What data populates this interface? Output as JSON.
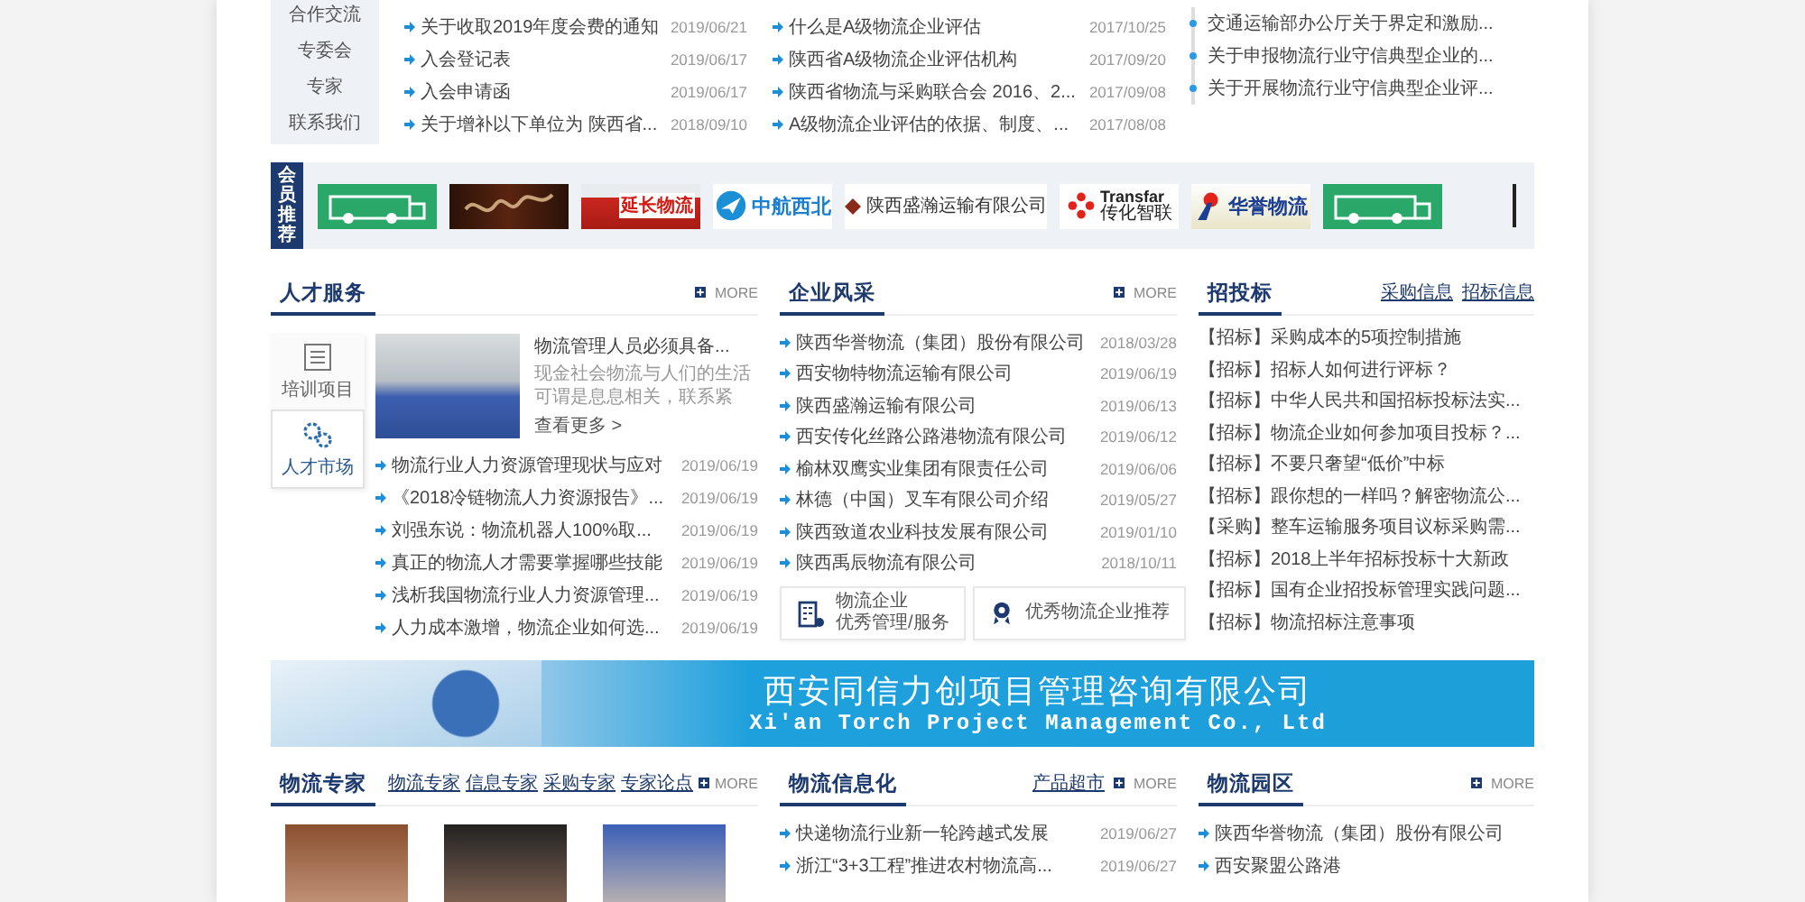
{
  "top": {
    "nav": [
      "合作交流",
      "专委会",
      "专家",
      "联系我们"
    ],
    "list_1": [
      {
        "title": "关于收取2019年度会费的通知",
        "date": "2019/06/21"
      },
      {
        "title": "入会登记表",
        "date": "2019/06/17"
      },
      {
        "title": "入会申请函",
        "date": "2019/06/17"
      },
      {
        "title": "关于增补以下单位为 陕西省...",
        "date": "2018/09/10"
      }
    ],
    "list_2": [
      {
        "title": "什么是A级物流企业评估",
        "date": "2017/10/25"
      },
      {
        "title": "陕西省A级物流企业评估机构",
        "date": "2017/09/20"
      },
      {
        "title": "陕西省物流与采购联合会 2016、2...",
        "date": "2017/09/08"
      },
      {
        "title": "A级物流企业评估的依据、制度、...",
        "date": "2017/08/08"
      }
    ],
    "list_3": [
      "交通运输部办公厅关于界定和激励...",
      "关于申报物流行业守信典型企业的...",
      "关于开展物流行业守信典型企业评..."
    ]
  },
  "members": {
    "badge": "会员推荐",
    "logos": [
      {
        "kind": "green"
      },
      {
        "kind": "script"
      },
      {
        "kind": "truck",
        "text": "延长物流"
      },
      {
        "kind": "plane",
        "text": "中航西北"
      },
      {
        "kind": "diamond",
        "text": "陕西盛瀚运输有限公司"
      },
      {
        "kind": "transfar",
        "text": "Transfar",
        "sub": "传化智联"
      },
      {
        "kind": "huayu",
        "text": "华誉物流"
      },
      {
        "kind": "green"
      }
    ]
  },
  "talent": {
    "title": "人才服务",
    "more": "MORE",
    "tabs": [
      {
        "label": "培训项目",
        "kind": "list",
        "selected": false
      },
      {
        "label": "人才市场",
        "kind": "gears",
        "selected": true
      }
    ],
    "feature": {
      "title": "物流管理人员必须具备...",
      "desc": "现金社会物流与人们的生活可谓是息息相关，联系紧",
      "link": "查看更多 >"
    },
    "items": [
      {
        "title": "物流行业人力资源管理现状与应对",
        "date": "2019/06/19"
      },
      {
        "title": "《2018冷链物流人力资源报告》...",
        "date": "2019/06/19"
      },
      {
        "title": "刘强东说：物流机器人100%取...",
        "date": "2019/06/19"
      },
      {
        "title": "真正的物流人才需要掌握哪些技能",
        "date": "2019/06/19"
      },
      {
        "title": "浅析我国物流行业人力资源管理...",
        "date": "2019/06/19"
      },
      {
        "title": "人力成本激增，物流企业如何选...",
        "date": "2019/06/19"
      }
    ]
  },
  "companies": {
    "title": "企业风采",
    "more": "MORE",
    "items": [
      {
        "title": "陕西华誉物流（集团）股份有限公司",
        "date": "2018/03/28"
      },
      {
        "title": "西安物特物流运输有限公司",
        "date": "2019/06/19"
      },
      {
        "title": "陕西盛瀚运输有限公司",
        "date": "2019/06/13"
      },
      {
        "title": "西安传化丝路公路港物流有限公司",
        "date": "2019/06/12"
      },
      {
        "title": "榆林双鹰实业集团有限责任公司",
        "date": "2019/06/06"
      },
      {
        "title": "林德（中国）叉车有限公司介绍",
        "date": "2019/05/27"
      },
      {
        "title": "陕西致道农业科技发展有限公司",
        "date": "2019/01/10"
      },
      {
        "title": "陕西禹辰物流有限公司",
        "date": "2018/10/11"
      }
    ],
    "buttons": [
      {
        "kind": "building",
        "lines": [
          "物流企业",
          "优秀管理/服务"
        ]
      },
      {
        "kind": "award",
        "lines": [
          "优秀物流企业推荐"
        ]
      }
    ]
  },
  "bidding": {
    "title": "招投标",
    "links": [
      "采购信息",
      "招标信息"
    ],
    "items": [
      "【招标】采购成本的5项控制措施",
      "【招标】招标人如何进行评标？",
      "【招标】中华人民共和国招标投标法实...",
      "【招标】物流企业如何参加项目投标？...",
      "【招标】不要只奢望“低价”中标",
      "【招标】跟你想的一样吗？解密物流公...",
      "【采购】整车运输服务项目议标采购需...",
      "【招标】2018上半年招标投标十大新政",
      "【招标】国有企业招投标管理实践问题...",
      "【招标】物流招标注意事项"
    ]
  },
  "banner": {
    "name": "西安同信力创项目管理咨询有限公司",
    "name_en": "Xi'an Torch Project Management Co., Ltd"
  },
  "experts": {
    "title": "物流专家",
    "links": [
      "物流专家",
      "信息专家",
      "采购专家",
      "专家论点"
    ],
    "more": "MORE"
  },
  "it": {
    "title": "物流信息化",
    "links": [
      "产品超市"
    ],
    "more": "MORE",
    "items": [
      {
        "title": "快递物流行业新一轮跨越式发展",
        "date": "2019/06/27"
      },
      {
        "title": "浙江“3+3工程”推进农村物流高...",
        "date": "2019/06/27"
      }
    ]
  },
  "parks": {
    "title": "物流园区",
    "more": "MORE",
    "items": [
      "陕西华誉物流（集团）股份有限公司",
      "西安聚盟公路港"
    ]
  }
}
